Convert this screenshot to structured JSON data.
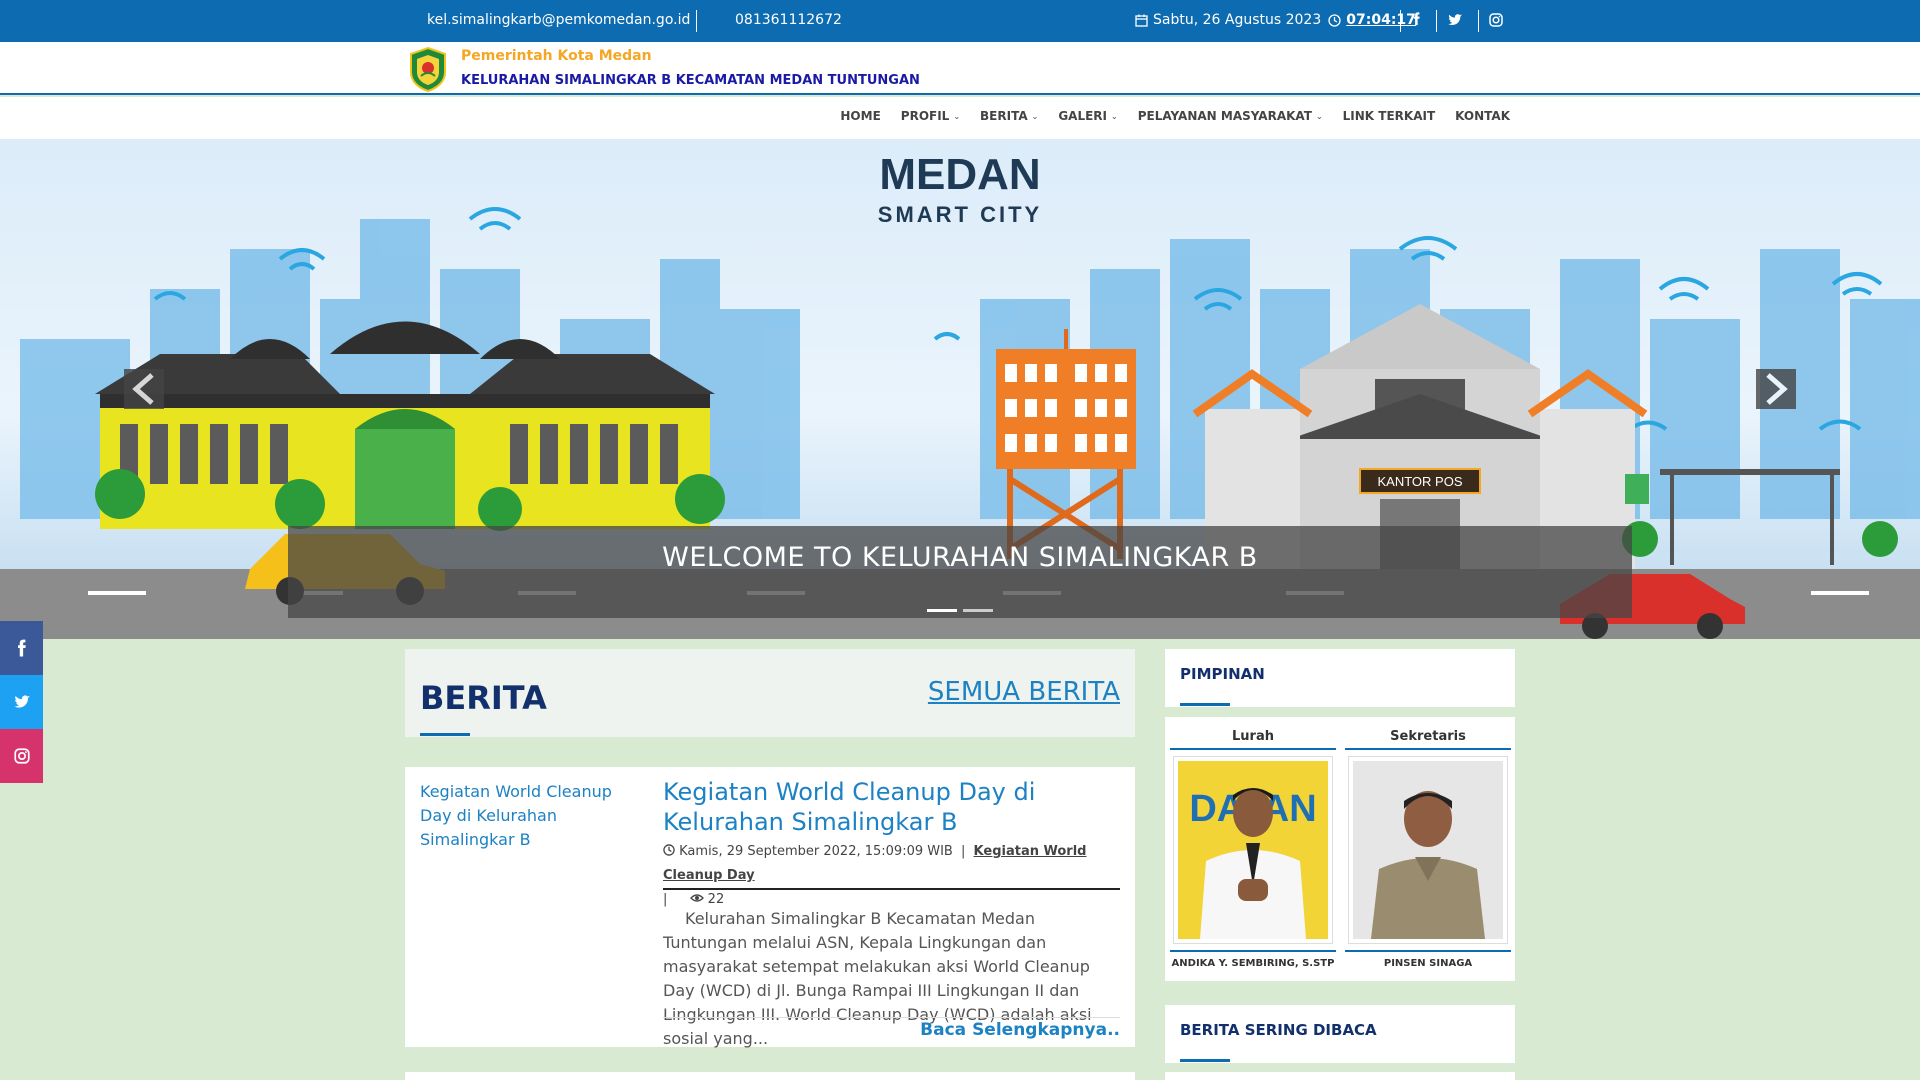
{
  "topbar": {
    "email": "kel.simalingkarb@pemkomedan.go.id",
    "phone": "081361112672",
    "date": "Sabtu, 26 Agustus 2023",
    "time": "07:04:17",
    "social_icons": [
      "facebook-icon",
      "twitter-icon",
      "instagram-icon"
    ]
  },
  "header": {
    "org_name": "Pemerintah Kota Medan",
    "subtitle": "KELURAHAN SIMALINGKAR B KECAMATAN MEDAN TUNTUNGAN"
  },
  "nav": {
    "items": [
      {
        "label": "HOME",
        "dropdown": false
      },
      {
        "label": "PROFIL",
        "dropdown": true
      },
      {
        "label": "BERITA",
        "dropdown": true
      },
      {
        "label": "GALERI",
        "dropdown": true
      },
      {
        "label": "PELAYANAN MASYARAKAT",
        "dropdown": true
      },
      {
        "label": "LINK TERKAIT",
        "dropdown": false
      },
      {
        "label": "KONTAK",
        "dropdown": false
      }
    ]
  },
  "hero": {
    "brand_line1": "MEDAN",
    "brand_line2": "SMART CITY",
    "sign_text": "KANTOR POS",
    "caption": "WELCOME TO KELURAHAN SIMALINGKAR B",
    "slide_count": 2,
    "active_slide": 1
  },
  "berita": {
    "title": "BERITA",
    "all_link": "SEMUA BERITA",
    "article": {
      "image_alt": "Kegiatan World Cleanup Day di Kelurahan Simalingkar B",
      "title": "Kegiatan World Cleanup Day di Kelurahan Simalingkar B",
      "date": "Kamis, 29 September 2022, 15:09:09 WIB",
      "category": "Kegiatan World Cleanup Day",
      "views": "22",
      "excerpt": "Kelurahan Simalingkar B Kecamatan Medan Tuntungan melalui ASN, Kepala Lingkungan dan masyarakat setempat melakukan aksi World Cleanup Day (WCD) di Jl. Bunga Rampai III Lingkungan II dan Lingkungan III. World Cleanup Day (WCD) adalah aksi sosial yang...",
      "read_more": "Baca Selengkapnya.."
    }
  },
  "pimpinan": {
    "title": "PIMPINAN",
    "people": [
      {
        "role": "Lurah",
        "name": "ANDIKA Y. SEMBIRING, S.STP",
        "photo_text": "DATAN"
      },
      {
        "role": "Sekretaris",
        "name": "PINSEN SINAGA",
        "photo_text": ""
      }
    ]
  },
  "sering_dibaca": {
    "title": "BERITA SERING DIBACA"
  },
  "colors": {
    "topbar": "#0c6bb1",
    "heading": "#12306b",
    "link": "#1c82c4",
    "facebook": "#3b5998",
    "twitter": "#1da1f2",
    "instagram": "#d6336c"
  }
}
